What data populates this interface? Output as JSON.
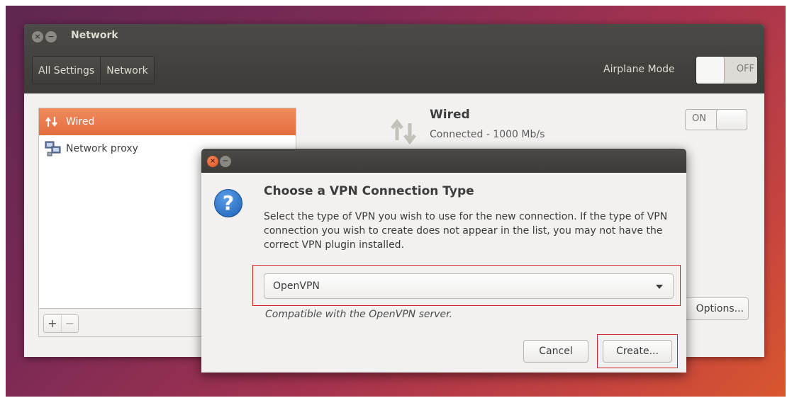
{
  "window": {
    "title": "Network",
    "breadcrumbs": [
      "All Settings",
      "Network"
    ],
    "airplane_mode_label": "Airplane Mode",
    "airplane_mode_state": "OFF"
  },
  "connections": [
    {
      "label": "Wired",
      "icon": "wired-arrows-icon",
      "selected": true
    },
    {
      "label": "Network proxy",
      "icon": "network-proxy-icon",
      "selected": false
    }
  ],
  "list_controls": {
    "add": "+",
    "remove": "−"
  },
  "detail": {
    "title": "Wired",
    "status": "Connected - 1000 Mb/s",
    "switch_state": "ON",
    "options_label": "Options..."
  },
  "dialog": {
    "heading": "Choose a VPN Connection Type",
    "description": "Select the type of VPN you wish to use for the new connection.  If the type of VPN connection you wish to create does not appear in the list, you may not have the correct VPN plugin installed.",
    "selected_type": "OpenVPN",
    "type_hint": "Compatible with the OpenVPN server.",
    "cancel_label": "Cancel",
    "create_label": "Create...",
    "icon": "question-icon"
  },
  "colors": {
    "accent": "#e8743f",
    "titlebar": "#3c3b37",
    "highlight_outline": "#d0242b"
  }
}
